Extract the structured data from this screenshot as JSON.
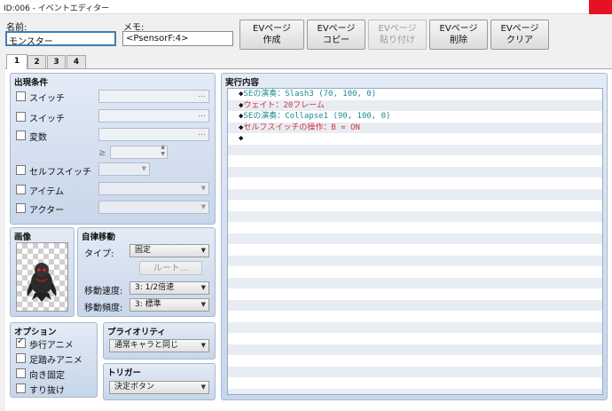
{
  "window": {
    "title": "ID:006 - イベントエディター"
  },
  "header": {
    "name_label": "名前:",
    "name_value": "モンスター",
    "memo_label": "メモ:",
    "memo_value": "<PsensorF:4>",
    "buttons": {
      "create": [
        "EVページ",
        "作成"
      ],
      "copy": [
        "EVページ",
        "コピー"
      ],
      "paste": [
        "EVページ",
        "貼り付け"
      ],
      "delete": [
        "EVページ",
        "削除"
      ],
      "clear": [
        "EVページ",
        "クリア"
      ]
    }
  },
  "tabs": [
    "1",
    "2",
    "3",
    "4"
  ],
  "conditions": {
    "title": "出現条件",
    "switch1": "スイッチ",
    "switch2": "スイッチ",
    "variable": "変数",
    "gte": "≥",
    "selfswitch": "セルフスイッチ",
    "item": "アイテム",
    "actor": "アクター",
    "dots": "..."
  },
  "image": {
    "title": "画像"
  },
  "autonomous": {
    "title": "自律移動",
    "type_label": "タイプ:",
    "type_value": "固定",
    "route_button": "ルート...",
    "speed_label": "移動速度:",
    "speed_value": "3: 1/2倍速",
    "freq_label": "移動頻度:",
    "freq_value": "3: 標準"
  },
  "options": {
    "title": "オプション",
    "walking": "歩行アニメ",
    "stepping": "足踏みアニメ",
    "direction_fix": "向き固定",
    "through": "すり抜け",
    "walking_checked": true
  },
  "priority": {
    "title": "プライオリティ",
    "value": "通常キャラと同じ"
  },
  "trigger": {
    "title": "トリガー",
    "value": "決定ボタン"
  },
  "contents": {
    "title": "実行内容",
    "bullet": "◆",
    "commands": [
      {
        "text": "SEの演奏：Slash3 (70, 100, 0)",
        "color": "#1a8a94"
      },
      {
        "text": "ウェイト：20フレーム",
        "color": "#d1303a"
      },
      {
        "text": "SEの演奏：Collapse1 (90, 100, 0)",
        "color": "#1a8a94"
      },
      {
        "text": "セルフスイッチの操作：B = ON",
        "color": "#d1303a"
      },
      {
        "text": "",
        "color": "#111111"
      }
    ]
  }
}
